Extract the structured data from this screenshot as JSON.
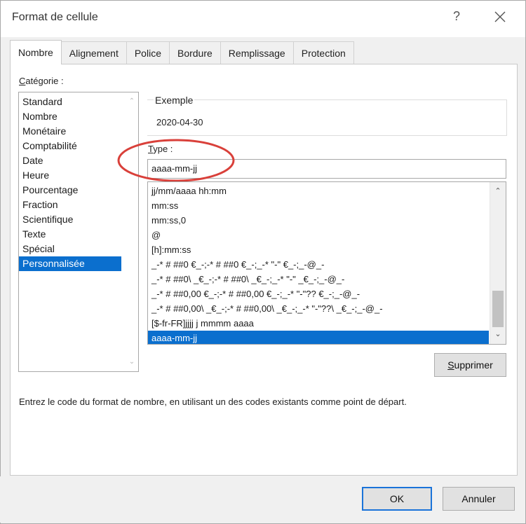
{
  "window": {
    "title": "Format de cellule",
    "help_label": "?"
  },
  "tabs": [
    {
      "label": "Nombre",
      "active": true
    },
    {
      "label": "Alignement",
      "active": false
    },
    {
      "label": "Police",
      "active": false
    },
    {
      "label": "Bordure",
      "active": false
    },
    {
      "label": "Remplissage",
      "active": false
    },
    {
      "label": "Protection",
      "active": false
    }
  ],
  "category": {
    "label_prefix": "C",
    "label_rest": "atégorie :",
    "items": [
      "Standard",
      "Nombre",
      "Monétaire",
      "Comptabilité",
      "Date",
      "Heure",
      "Pourcentage",
      "Fraction",
      "Scientifique",
      "Texte",
      "Spécial",
      "Personnalisée"
    ],
    "selected": "Personnalisée"
  },
  "sample": {
    "label": "Exemple",
    "value": "2020-04-30"
  },
  "type": {
    "label_prefix": "T",
    "label_rest": "ype :",
    "value": "aaaa-mm-jj"
  },
  "format_list": {
    "items": [
      "jj/mm/aaaa hh:mm",
      "mm:ss",
      "mm:ss,0",
      "@",
      "[h]:mm:ss",
      "_-* # ##0 €_-;-* # ##0 €_-;_-* \"-\" €_-;_-@_-",
      "_-* # ##0\\ _€_-;-* # ##0\\ _€_-;_-* \"-\" _€_-;_-@_-",
      "_-* # ##0,00 €_-;-* # ##0,00 €_-;_-* \"-\"?? €_-;_-@_-",
      "_-* # ##0,00\\ _€_-;-* # ##0,00\\ _€_-;_-* \"-\"??\\ _€_-;_-@_-",
      "[$-fr-FR]jjjj j mmmm aaaa",
      "aaaa-mm-jj"
    ],
    "selected": "aaaa-mm-jj"
  },
  "buttons": {
    "delete_prefix": "S",
    "delete_rest": "upprimer",
    "ok": "OK",
    "cancel": "Annuler"
  },
  "hint": "Entrez le code du format de nombre, en utilisant un des codes existants comme point de départ.",
  "colors": {
    "selection": "#0b6fce",
    "highlight_ellipse": "#d9403a",
    "default_button_border": "#1a73d9"
  }
}
